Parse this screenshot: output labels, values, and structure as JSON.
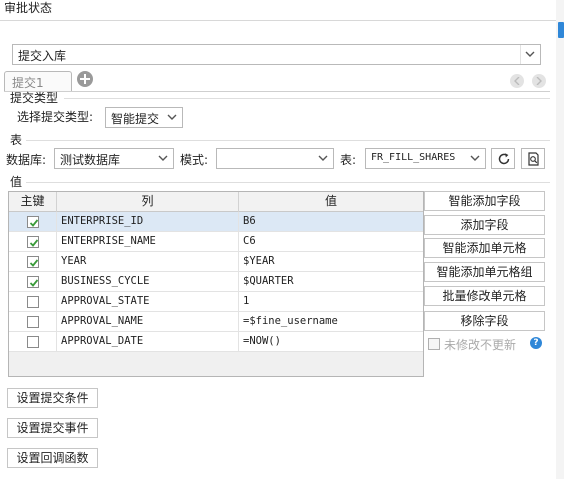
{
  "window": {
    "title": "审批状态"
  },
  "submit_mode": {
    "value": "提交入库"
  },
  "tabs": [
    {
      "label": "提交1"
    }
  ],
  "submit_type": {
    "section_label": "提交类型",
    "field_label": "选择提交类型:",
    "value": "智能提交"
  },
  "table_section": {
    "section_label": "表",
    "database_label": "数据库:",
    "database_value": "测试数据库",
    "schema_label": "模式:",
    "schema_value": "",
    "table_label": "表:",
    "table_value": "FR_FILL_SHARES"
  },
  "value_section": {
    "section_label": "值",
    "columns": [
      "主键",
      "列",
      "值"
    ],
    "rows": [
      {
        "key": true,
        "column": "ENTERPRISE_ID",
        "value": "B6"
      },
      {
        "key": true,
        "column": "ENTERPRISE_NAME",
        "value": "C6"
      },
      {
        "key": true,
        "column": "YEAR",
        "value": "$YEAR"
      },
      {
        "key": true,
        "column": "BUSINESS_CYCLE",
        "value": "$QUARTER"
      },
      {
        "key": false,
        "column": "APPROVAL_STATE",
        "value": "1"
      },
      {
        "key": false,
        "column": "APPROVAL_NAME",
        "value": "=$fine_username"
      },
      {
        "key": false,
        "column": "APPROVAL_DATE",
        "value": "=NOW()"
      }
    ]
  },
  "side_buttons": {
    "smart_add_field": "智能添加字段",
    "add_field": "添加字段",
    "smart_add_cell": "智能添加单元格",
    "smart_add_cell_group": "智能添加单元格组",
    "batch_modify_cell": "批量修改单元格",
    "remove_field": "移除字段",
    "no_update_unmodified": "未修改不更新"
  },
  "bottom_buttons": {
    "set_condition": "设置提交条件",
    "set_event": "设置提交事件",
    "set_callback": "设置回调函数"
  },
  "colors": {
    "accent": "#2f87d8",
    "selected_row": "#dce8f5",
    "check": "#3a9b3a"
  },
  "icons": [
    "add-tab-icon",
    "tab-prev-icon",
    "tab-next-icon",
    "chevron-down-icon",
    "refresh-icon",
    "preview-icon",
    "help-icon",
    "check-icon"
  ]
}
